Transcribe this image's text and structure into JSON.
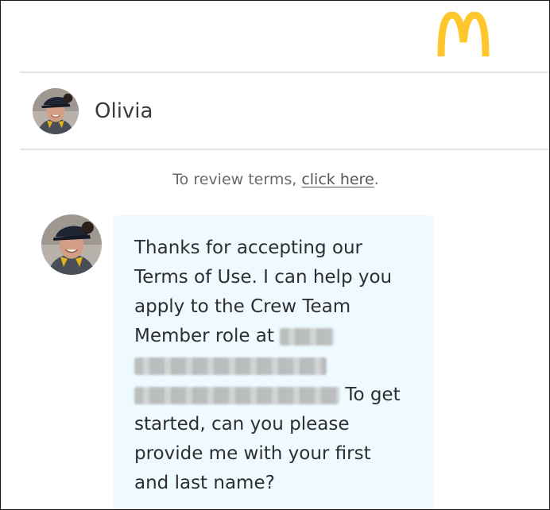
{
  "brand": {
    "logo_icon": "golden-arches-icon",
    "logo_color": "#FFC72C"
  },
  "header": {
    "agent_name": "Olivia",
    "avatar_icon": "agent-avatar-icon"
  },
  "terms": {
    "prefix": "To review terms, ",
    "link_text": "click here",
    "suffix": "."
  },
  "message": {
    "lines": [
      "Thanks for accepting our",
      "Terms of Use. I can help you",
      "apply to the Crew Team",
      "Member role at",
      "",
      "To get",
      "started, can you please",
      "provide me with your first",
      "and last name?"
    ],
    "bubble_color": "#EEFAFF"
  }
}
